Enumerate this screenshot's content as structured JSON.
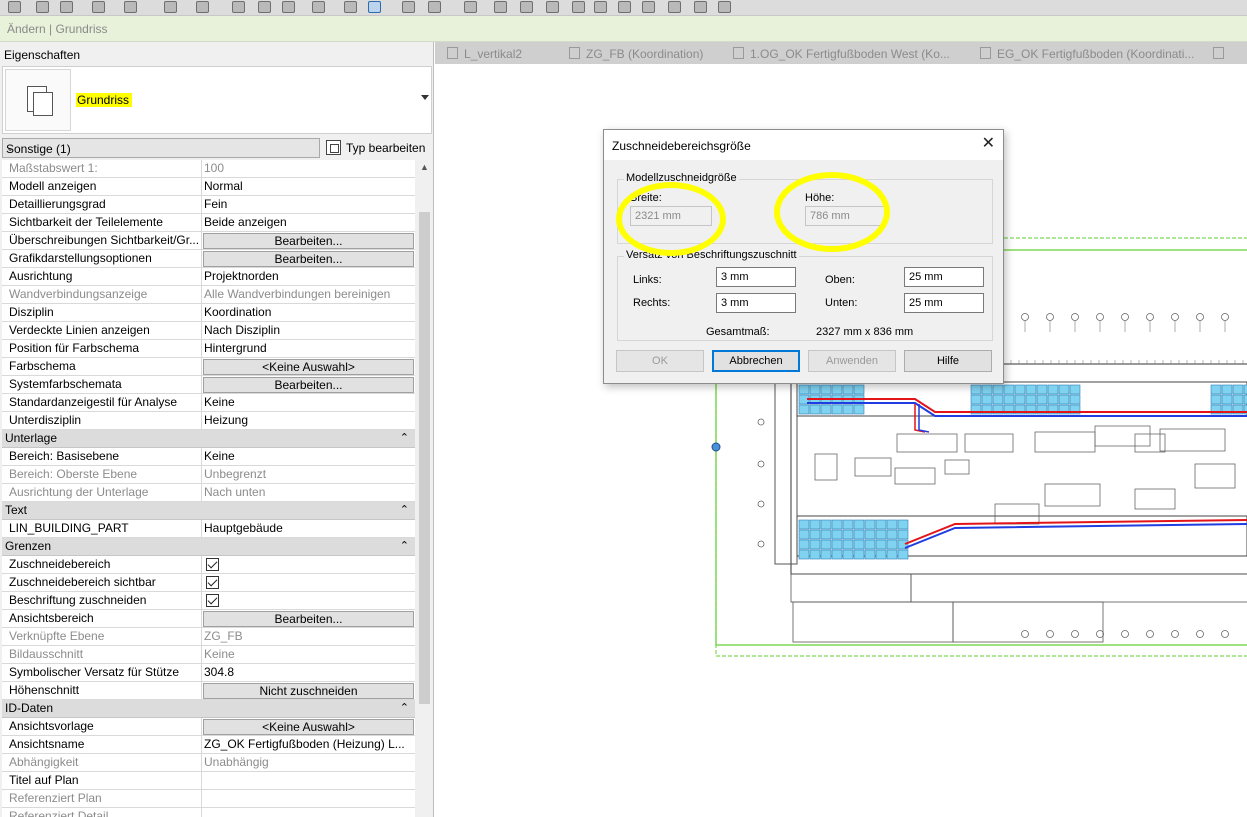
{
  "context_bar": "Ändern | Grundriss",
  "properties": {
    "title": "Eigenschaften",
    "type_name": "Grundriss",
    "selector": "Sonstige (1)",
    "edit_type": "Typ bearbeiten",
    "rows": [
      {
        "kind": "row",
        "key": "Maßstabswert 1:",
        "value": "100",
        "dim": true
      },
      {
        "kind": "row",
        "key": "Modell anzeigen",
        "value": "Normal"
      },
      {
        "kind": "row",
        "key": "Detaillierungsgrad",
        "value": "Fein"
      },
      {
        "kind": "row",
        "key": "Sichtbarkeit der Teilelemente",
        "value": "Beide anzeigen"
      },
      {
        "kind": "button",
        "key": "Überschreibungen Sichtbarkeit/Gr...",
        "value": "Bearbeiten..."
      },
      {
        "kind": "button",
        "key": "Grafikdarstellungsoptionen",
        "value": "Bearbeiten..."
      },
      {
        "kind": "row",
        "key": "Ausrichtung",
        "value": "Projektnorden"
      },
      {
        "kind": "row",
        "key": "Wandverbindungsanzeige",
        "value": "Alle Wandverbindungen bereinigen",
        "dim": true
      },
      {
        "kind": "row",
        "key": "Disziplin",
        "value": "Koordination"
      },
      {
        "kind": "row",
        "key": "Verdeckte Linien anzeigen",
        "value": "Nach Disziplin"
      },
      {
        "kind": "row",
        "key": "Position für Farbschema",
        "value": "Hintergrund"
      },
      {
        "kind": "button",
        "key": "Farbschema",
        "value": "<Keine Auswahl>"
      },
      {
        "kind": "button",
        "key": "Systemfarbschemata",
        "value": "Bearbeiten..."
      },
      {
        "kind": "row",
        "key": "Standardanzeigestil für Analyse",
        "value": "Keine"
      },
      {
        "kind": "row",
        "key": "Unterdisziplin",
        "value": "Heizung"
      },
      {
        "kind": "section",
        "key": "Unterlage"
      },
      {
        "kind": "row",
        "key": "Bereich: Basisebene",
        "value": "Keine"
      },
      {
        "kind": "row",
        "key": "Bereich: Oberste Ebene",
        "value": "Unbegrenzt",
        "dim": true
      },
      {
        "kind": "row",
        "key": "Ausrichtung der Unterlage",
        "value": "Nach unten",
        "dim": true
      },
      {
        "kind": "section",
        "key": "Text"
      },
      {
        "kind": "row",
        "key": "LIN_BUILDING_PART",
        "value": "Hauptgebäude"
      },
      {
        "kind": "section",
        "key": "Grenzen"
      },
      {
        "kind": "check",
        "key": "Zuschneidebereich",
        "checked": true
      },
      {
        "kind": "check",
        "key": "Zuschneidebereich sichtbar",
        "checked": true
      },
      {
        "kind": "check",
        "key": "Beschriftung zuschneiden",
        "checked": true
      },
      {
        "kind": "button",
        "key": "Ansichtsbereich",
        "value": "Bearbeiten..."
      },
      {
        "kind": "row",
        "key": "Verknüpfte Ebene",
        "value": "ZG_FB",
        "dim": true
      },
      {
        "kind": "row",
        "key": "Bildausschnitt",
        "value": "Keine",
        "dim": true
      },
      {
        "kind": "row",
        "key": "Symbolischer Versatz für Stütze",
        "value": "304.8"
      },
      {
        "kind": "button",
        "key": "Höhenschnitt",
        "value": "Nicht zuschneiden"
      },
      {
        "kind": "section",
        "key": "ID-Daten"
      },
      {
        "kind": "button",
        "key": "Ansichtsvorlage",
        "value": "<Keine Auswahl>"
      },
      {
        "kind": "row",
        "key": "Ansichtsname",
        "value": "ZG_OK Fertigfußboden (Heizung) L..."
      },
      {
        "kind": "row",
        "key": "Abhängigkeit",
        "value": "Unabhängig",
        "dim": true
      },
      {
        "kind": "row",
        "key": "Titel auf Plan",
        "value": ""
      },
      {
        "kind": "row",
        "key": "Referenziert Plan",
        "value": "",
        "dim": true
      },
      {
        "kind": "row",
        "key": "Referenziert Detail",
        "value": "",
        "dim": true
      }
    ]
  },
  "tabs": [
    {
      "label": "L_vertikal2"
    },
    {
      "label": "ZG_FB (Koordination)"
    },
    {
      "label": "1.OG_OK Fertigfußboden West (Ko..."
    },
    {
      "label": "EG_OK Fertigfußboden (Koordinati..."
    },
    {
      "label": ""
    }
  ],
  "dialog": {
    "title": "Zuschneidebereichsgröße",
    "group_model": "Modellzuschneidgröße",
    "width_label": "Breite:",
    "width_value": "2321 mm",
    "height_label": "Höhe:",
    "height_value": "786 mm",
    "group_offset": "Versatz von Beschriftungszuschnitt",
    "left_label": "Links:",
    "left_value": "3 mm",
    "top_label": "Oben:",
    "top_value": "25 mm",
    "right_label": "Rechts:",
    "right_value": "3 mm",
    "bottom_label": "Unten:",
    "bottom_value": "25 mm",
    "total_label": "Gesamtmaß:",
    "total_value": "2327 mm x 836 mm",
    "buttons": {
      "ok": "OK",
      "cancel": "Abbrechen",
      "apply": "Anwenden",
      "help": "Hilfe"
    }
  },
  "colors": {
    "highlight": "#ffff00",
    "context_bar": "#e8f2da",
    "crop_region": "#7ed957",
    "duct_fill": "#7fd3f0",
    "pipe_red": "#e2141a",
    "pipe_blue": "#1f3de0"
  }
}
